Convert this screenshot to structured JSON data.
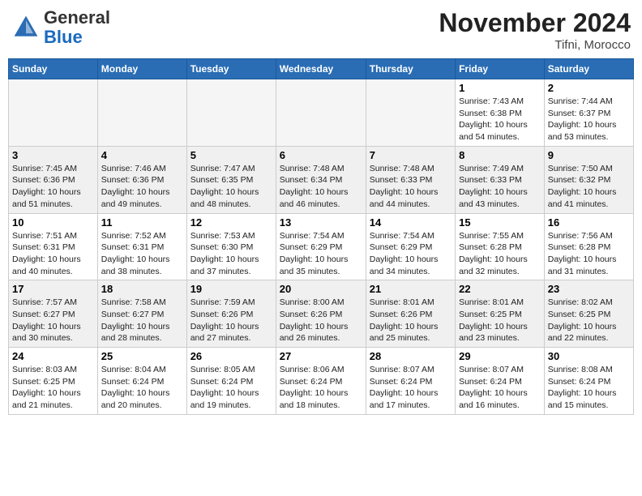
{
  "header": {
    "logo_general": "General",
    "logo_blue": "Blue",
    "month_title": "November 2024",
    "location": "Tifni, Morocco"
  },
  "days_of_week": [
    "Sunday",
    "Monday",
    "Tuesday",
    "Wednesday",
    "Thursday",
    "Friday",
    "Saturday"
  ],
  "weeks": [
    [
      {
        "day": "",
        "empty": true
      },
      {
        "day": "",
        "empty": true
      },
      {
        "day": "",
        "empty": true
      },
      {
        "day": "",
        "empty": true
      },
      {
        "day": "",
        "empty": true
      },
      {
        "day": "1",
        "sunrise": "Sunrise: 7:43 AM",
        "sunset": "Sunset: 6:38 PM",
        "daylight": "Daylight: 10 hours and 54 minutes."
      },
      {
        "day": "2",
        "sunrise": "Sunrise: 7:44 AM",
        "sunset": "Sunset: 6:37 PM",
        "daylight": "Daylight: 10 hours and 53 minutes."
      }
    ],
    [
      {
        "day": "3",
        "sunrise": "Sunrise: 7:45 AM",
        "sunset": "Sunset: 6:36 PM",
        "daylight": "Daylight: 10 hours and 51 minutes."
      },
      {
        "day": "4",
        "sunrise": "Sunrise: 7:46 AM",
        "sunset": "Sunset: 6:36 PM",
        "daylight": "Daylight: 10 hours and 49 minutes."
      },
      {
        "day": "5",
        "sunrise": "Sunrise: 7:47 AM",
        "sunset": "Sunset: 6:35 PM",
        "daylight": "Daylight: 10 hours and 48 minutes."
      },
      {
        "day": "6",
        "sunrise": "Sunrise: 7:48 AM",
        "sunset": "Sunset: 6:34 PM",
        "daylight": "Daylight: 10 hours and 46 minutes."
      },
      {
        "day": "7",
        "sunrise": "Sunrise: 7:48 AM",
        "sunset": "Sunset: 6:33 PM",
        "daylight": "Daylight: 10 hours and 44 minutes."
      },
      {
        "day": "8",
        "sunrise": "Sunrise: 7:49 AM",
        "sunset": "Sunset: 6:33 PM",
        "daylight": "Daylight: 10 hours and 43 minutes."
      },
      {
        "day": "9",
        "sunrise": "Sunrise: 7:50 AM",
        "sunset": "Sunset: 6:32 PM",
        "daylight": "Daylight: 10 hours and 41 minutes."
      }
    ],
    [
      {
        "day": "10",
        "sunrise": "Sunrise: 7:51 AM",
        "sunset": "Sunset: 6:31 PM",
        "daylight": "Daylight: 10 hours and 40 minutes."
      },
      {
        "day": "11",
        "sunrise": "Sunrise: 7:52 AM",
        "sunset": "Sunset: 6:31 PM",
        "daylight": "Daylight: 10 hours and 38 minutes."
      },
      {
        "day": "12",
        "sunrise": "Sunrise: 7:53 AM",
        "sunset": "Sunset: 6:30 PM",
        "daylight": "Daylight: 10 hours and 37 minutes."
      },
      {
        "day": "13",
        "sunrise": "Sunrise: 7:54 AM",
        "sunset": "Sunset: 6:29 PM",
        "daylight": "Daylight: 10 hours and 35 minutes."
      },
      {
        "day": "14",
        "sunrise": "Sunrise: 7:54 AM",
        "sunset": "Sunset: 6:29 PM",
        "daylight": "Daylight: 10 hours and 34 minutes."
      },
      {
        "day": "15",
        "sunrise": "Sunrise: 7:55 AM",
        "sunset": "Sunset: 6:28 PM",
        "daylight": "Daylight: 10 hours and 32 minutes."
      },
      {
        "day": "16",
        "sunrise": "Sunrise: 7:56 AM",
        "sunset": "Sunset: 6:28 PM",
        "daylight": "Daylight: 10 hours and 31 minutes."
      }
    ],
    [
      {
        "day": "17",
        "sunrise": "Sunrise: 7:57 AM",
        "sunset": "Sunset: 6:27 PM",
        "daylight": "Daylight: 10 hours and 30 minutes."
      },
      {
        "day": "18",
        "sunrise": "Sunrise: 7:58 AM",
        "sunset": "Sunset: 6:27 PM",
        "daylight": "Daylight: 10 hours and 28 minutes."
      },
      {
        "day": "19",
        "sunrise": "Sunrise: 7:59 AM",
        "sunset": "Sunset: 6:26 PM",
        "daylight": "Daylight: 10 hours and 27 minutes."
      },
      {
        "day": "20",
        "sunrise": "Sunrise: 8:00 AM",
        "sunset": "Sunset: 6:26 PM",
        "daylight": "Daylight: 10 hours and 26 minutes."
      },
      {
        "day": "21",
        "sunrise": "Sunrise: 8:01 AM",
        "sunset": "Sunset: 6:26 PM",
        "daylight": "Daylight: 10 hours and 25 minutes."
      },
      {
        "day": "22",
        "sunrise": "Sunrise: 8:01 AM",
        "sunset": "Sunset: 6:25 PM",
        "daylight": "Daylight: 10 hours and 23 minutes."
      },
      {
        "day": "23",
        "sunrise": "Sunrise: 8:02 AM",
        "sunset": "Sunset: 6:25 PM",
        "daylight": "Daylight: 10 hours and 22 minutes."
      }
    ],
    [
      {
        "day": "24",
        "sunrise": "Sunrise: 8:03 AM",
        "sunset": "Sunset: 6:25 PM",
        "daylight": "Daylight: 10 hours and 21 minutes."
      },
      {
        "day": "25",
        "sunrise": "Sunrise: 8:04 AM",
        "sunset": "Sunset: 6:24 PM",
        "daylight": "Daylight: 10 hours and 20 minutes."
      },
      {
        "day": "26",
        "sunrise": "Sunrise: 8:05 AM",
        "sunset": "Sunset: 6:24 PM",
        "daylight": "Daylight: 10 hours and 19 minutes."
      },
      {
        "day": "27",
        "sunrise": "Sunrise: 8:06 AM",
        "sunset": "Sunset: 6:24 PM",
        "daylight": "Daylight: 10 hours and 18 minutes."
      },
      {
        "day": "28",
        "sunrise": "Sunrise: 8:07 AM",
        "sunset": "Sunset: 6:24 PM",
        "daylight": "Daylight: 10 hours and 17 minutes."
      },
      {
        "day": "29",
        "sunrise": "Sunrise: 8:07 AM",
        "sunset": "Sunset: 6:24 PM",
        "daylight": "Daylight: 10 hours and 16 minutes."
      },
      {
        "day": "30",
        "sunrise": "Sunrise: 8:08 AM",
        "sunset": "Sunset: 6:24 PM",
        "daylight": "Daylight: 10 hours and 15 minutes."
      }
    ]
  ]
}
